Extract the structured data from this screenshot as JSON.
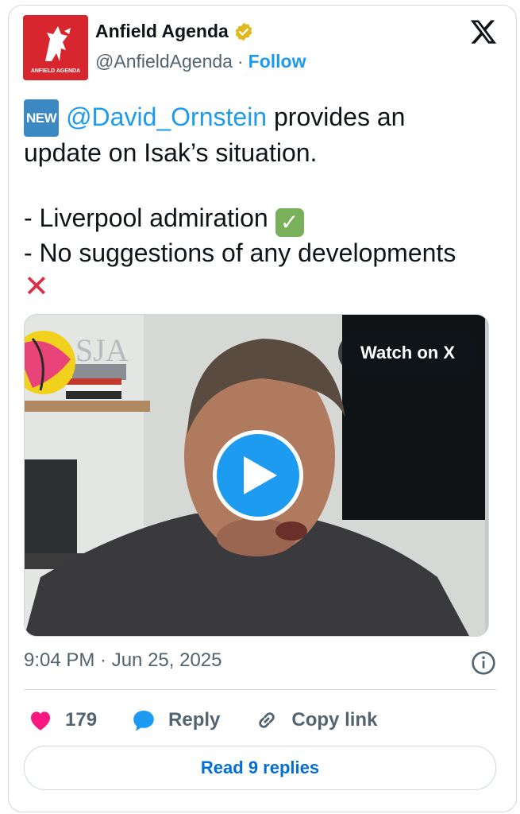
{
  "header": {
    "name": "Anfield Agenda",
    "handle": "@AnfieldAgenda",
    "separator": "·",
    "follow_label": "Follow",
    "avatar_caption": "ANFIELD AGENDA"
  },
  "tweet": {
    "badge": "NEW",
    "mention": "@David_Ornstein",
    "line1_rest": " provides an update on Isak’s situation.",
    "item1": "- Liverpool admiration ",
    "item2": "- No suggestions of any developments "
  },
  "media": {
    "watch_label": "Watch on X",
    "shelf_letters": "SJA"
  },
  "meta": {
    "time": "9:04 PM · Jun 25, 2025"
  },
  "actions": {
    "like_count": "179",
    "reply_label": "Reply",
    "copy_label": "Copy link"
  },
  "replies_button": "Read 9 replies",
  "colors": {
    "accent": "#1d9bf0",
    "brand_red": "#d7262e",
    "like_pink": "#f91880",
    "muted": "#536471"
  }
}
